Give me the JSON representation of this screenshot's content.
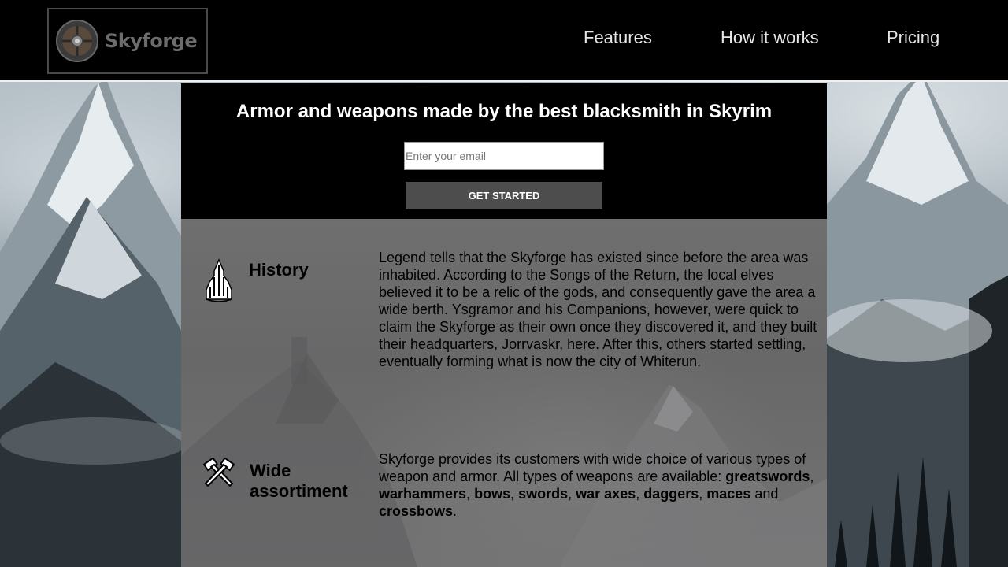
{
  "header": {
    "logo_text": "Skyforge",
    "nav": [
      "Features",
      "How it works",
      "Pricing"
    ]
  },
  "hero": {
    "title": "Armor and weapons made by the best blacksmith in Skyrim",
    "email_placeholder": "Enter your email",
    "cta_label": "GET STARTED"
  },
  "features": [
    {
      "icon": "castle-icon",
      "title": "History",
      "text": "Legend tells that the Skyforge has existed since before the area was inhabited. According to the Songs of the Return, the local elves believed it to be a relic of the gods, and consequently gave the area a wide berth. Ysgramor and his Companions, however, were quick to claim the Skyforge as their own once they discovered it, and they built their headquarters, Jorrvaskr, here. After this, others started settling, eventually forming what is now the city of Whiterun."
    },
    {
      "icon": "crossed-hammers-icon",
      "title": "Wide assortiment",
      "text_intro": "Skyforge provides its customers with wide choice of various types of weapon and armor. All types of weapons are available:",
      "weapons": [
        "greatswords",
        "warhammers",
        "bows",
        "swords",
        "war axes",
        "daggers",
        "maces",
        "crossbows"
      ],
      "separator": ", ",
      "last_joiner": " and ",
      "end": "."
    }
  ],
  "colors": {
    "header_bg": "#000000",
    "hero_bg": "#000000",
    "cta_bg": "#4d4d4d",
    "panel_bg": "#6d6d6e"
  }
}
